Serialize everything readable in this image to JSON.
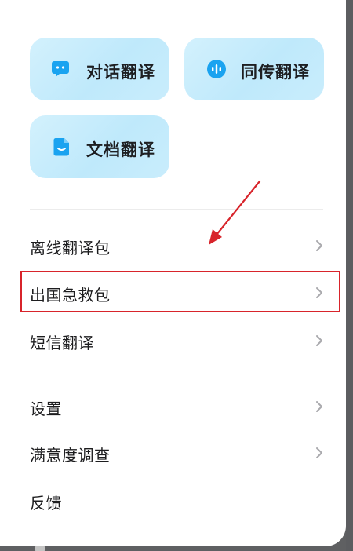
{
  "cards": [
    {
      "label": "对话翻译",
      "icon": "chat-bubble-icon"
    },
    {
      "label": "同传翻译",
      "icon": "soundwave-icon"
    },
    {
      "label": "文档翻译",
      "icon": "document-icon"
    }
  ],
  "menu": {
    "offline_pack": "离线翻译包",
    "emergency_kit": "出国急救包",
    "sms_translate": "短信翻译",
    "settings": "设置",
    "survey": "满意度调查",
    "feedback": "反馈"
  },
  "colors": {
    "accent": "#1aa3f0",
    "annotation": "#d8242b",
    "card_bg": "#c9edfc"
  }
}
